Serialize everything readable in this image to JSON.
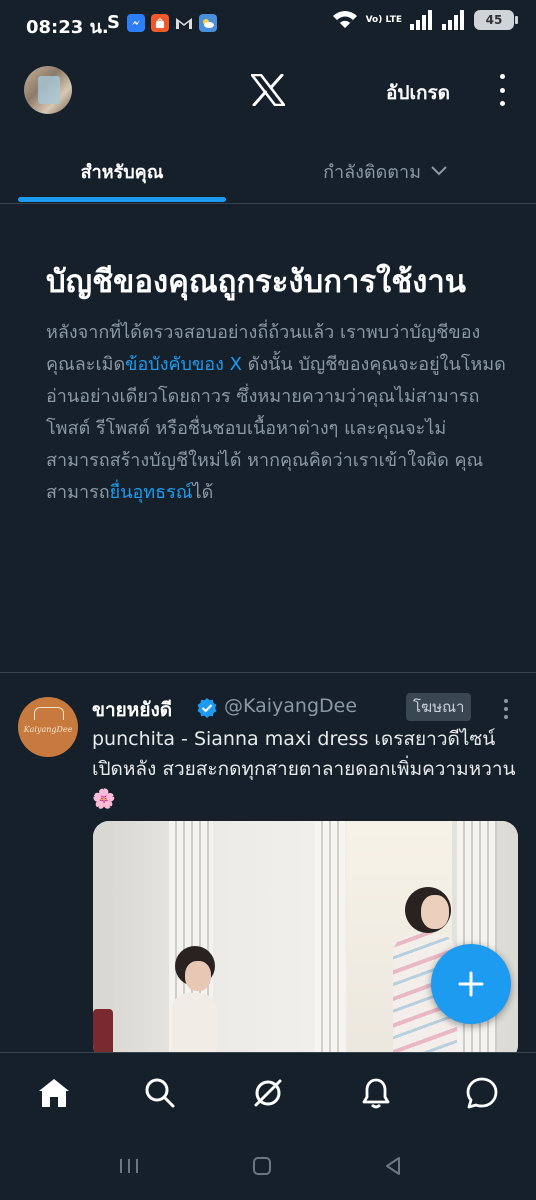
{
  "status_bar": {
    "time": "08:23 น.",
    "carrier_letter": "S",
    "lte_label": "Vo) LTE",
    "battery_level": "45",
    "app_icons": [
      "messenger-icon",
      "shopee-icon",
      "gmail-icon",
      "weather-icon"
    ]
  },
  "header": {
    "logo": "x-logo-icon",
    "upgrade_label": "อัปเกรด"
  },
  "tabs": [
    {
      "label": "สำหรับคุณ",
      "active": true
    },
    {
      "label": "กำลังติดตาม",
      "active": false
    }
  ],
  "notice": {
    "title": "บัญชีของคุณถูกระงับการใช้งาน",
    "body_part1": "หลังจากที่ได้ตรวจสอบอย่างถี่ถ้วนแล้ว เราพบว่าบัญชีของคุณละเมิด",
    "rules_link": "ข้อบังคับของ X",
    "body_part2": " ดังนั้น บัญชีของคุณจะอยู่ในโหมดอ่านอย่างเดียวโดยถาวร ซึ่งหมายความว่าคุณไม่สามารถโพสต์ รีโพสต์ หรือชื่นชอบเนื้อหาต่างๆ และคุณจะไม่สามารถสร้างบัญชีใหม่ได้ หากคุณคิดว่าเราเข้าใจผิด คุณสามารถ",
    "appeal_link": "ยื่นอุทธรณ์",
    "body_part3": "ได้"
  },
  "tweet": {
    "display_name": "ขายหยังดี",
    "handle": "@KaiyangDee",
    "avatar_text": "KaiyangDee",
    "ad_label": "โฆษณา",
    "text": "punchita - Sianna maxi dress เดรสยาวดีไซน์เปิดหลัง สวยสะกดทุกสายตาลายดอกเพิ่มความหวาน🌸"
  },
  "bottom_nav": [
    "home-icon",
    "search-icon",
    "grok-icon",
    "notifications-icon",
    "messages-icon"
  ],
  "colors": {
    "background": "#15202b",
    "accent": "#1d9bf0",
    "muted_text": "#8b98a5",
    "divider": "#38444d"
  }
}
